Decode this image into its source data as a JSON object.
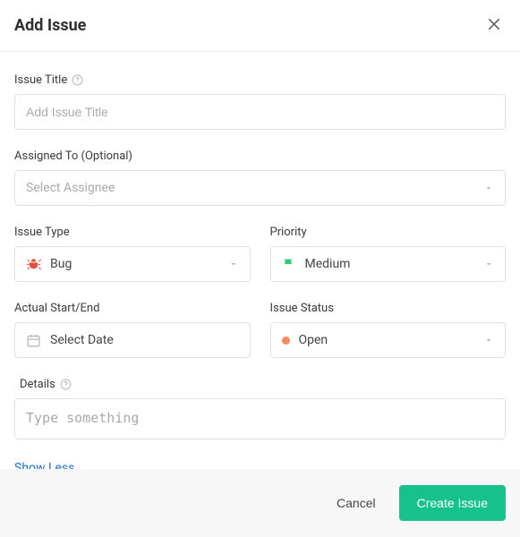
{
  "header": {
    "title": "Add Issue"
  },
  "fields": {
    "issueTitle": {
      "label": "Issue Title",
      "placeholder": "Add Issue Title",
      "value": ""
    },
    "assignedTo": {
      "label": "Assigned To (Optional)",
      "placeholder": "Select Assignee"
    },
    "issueType": {
      "label": "Issue Type",
      "value": "Bug"
    },
    "priority": {
      "label": "Priority",
      "value": "Medium"
    },
    "actualStartEnd": {
      "label": "Actual Start/End",
      "placeholder": "Select Date"
    },
    "issueStatus": {
      "label": "Issue Status",
      "value": "Open"
    },
    "details": {
      "label": "Details",
      "placeholder": "Type something",
      "value": ""
    }
  },
  "toggle": {
    "showLess": "Show Less"
  },
  "footer": {
    "cancel": "Cancel",
    "create": "Create Issue"
  }
}
